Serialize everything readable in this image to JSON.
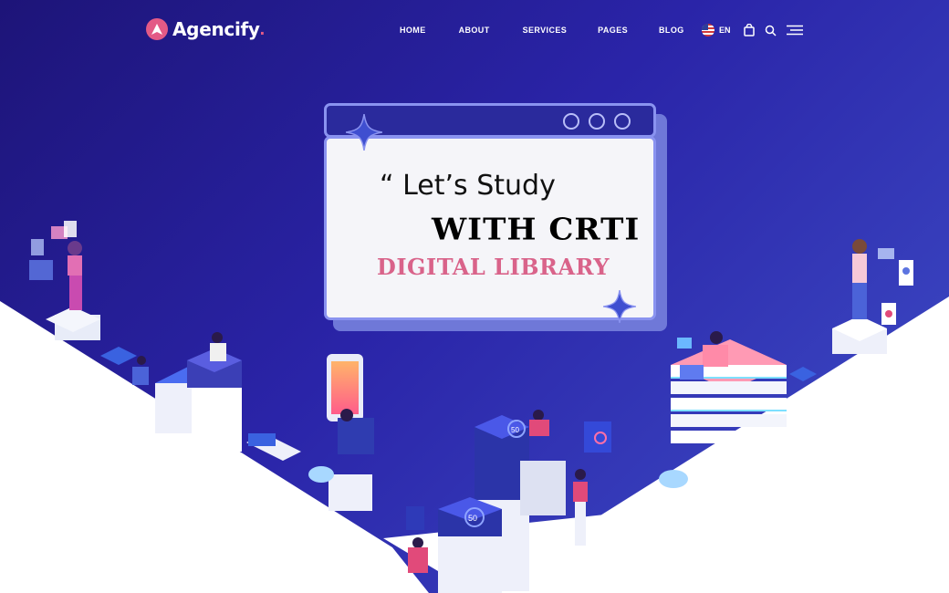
{
  "brand": {
    "name": "Agencify",
    "dot": ".",
    "accent": "#e35a86"
  },
  "nav": {
    "items": [
      {
        "label": "HOME"
      },
      {
        "label": "ABOUT"
      },
      {
        "label": "SERVICES"
      },
      {
        "label": "PAGES"
      },
      {
        "label": "BLOG"
      }
    ]
  },
  "tools": {
    "language": "EN",
    "icons": [
      "us-flag-icon",
      "shopping-bag-icon",
      "search-icon",
      "hamburger-menu-icon"
    ]
  },
  "hero": {
    "quote_mark": "“",
    "line1": "Let’s Study",
    "line2": "WITH CRTI",
    "line3": "DIGITAL LIBRARY",
    "line3_color": "#d9638a"
  },
  "illustration": {
    "badge_top": "50",
    "badge_bottom": "50"
  },
  "colors": {
    "background_start": "#1d1478",
    "background_end": "#3f4fc8",
    "card_border": "#8a93f0",
    "card_bar": "#2a2a9c"
  }
}
